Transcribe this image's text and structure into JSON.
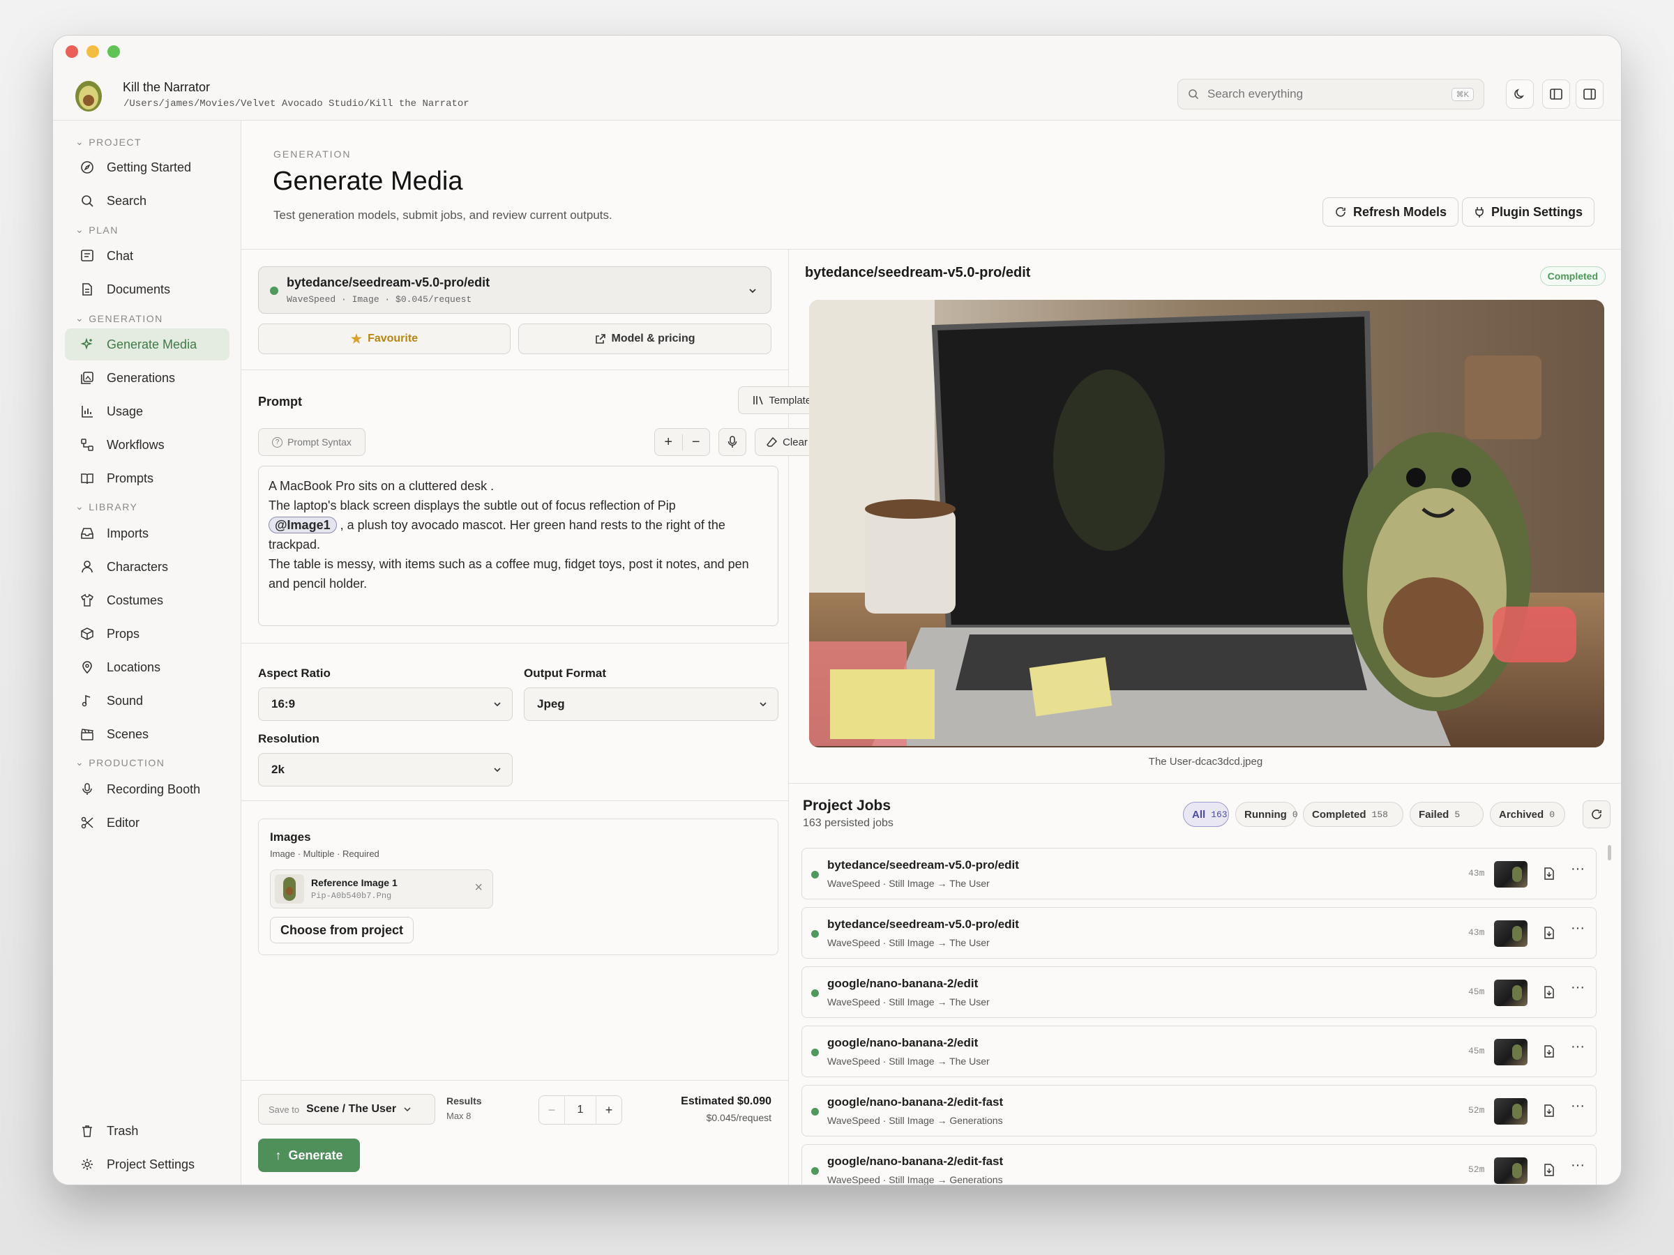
{
  "app": {
    "name": "Kill the Narrator",
    "path": "/Users/james/Movies/Velvet Avocado Studio/Kill the Narrator"
  },
  "search": {
    "placeholder": "Search everything",
    "shortcut": "⌘K"
  },
  "sidebar": {
    "sections": [
      "PROJECT",
      "PLAN",
      "GENERATION",
      "LIBRARY",
      "PRODUCTION"
    ],
    "items": [
      {
        "label": "Getting Started",
        "icon": "compass-icon"
      },
      {
        "label": "Search",
        "icon": "search-icon"
      },
      {
        "label": "Chat",
        "icon": "chat-icon"
      },
      {
        "label": "Documents",
        "icon": "document-icon"
      },
      {
        "label": "Generate Media",
        "icon": "sparkle-icon",
        "active": true
      },
      {
        "label": "Generations",
        "icon": "gallery-icon"
      },
      {
        "label": "Usage",
        "icon": "bar-chart-icon"
      },
      {
        "label": "Workflows",
        "icon": "workflow-icon"
      },
      {
        "label": "Prompts",
        "icon": "book-icon"
      },
      {
        "label": "Imports",
        "icon": "inbox-icon"
      },
      {
        "label": "Characters",
        "icon": "user-icon"
      },
      {
        "label": "Costumes",
        "icon": "shirt-icon"
      },
      {
        "label": "Props",
        "icon": "box-icon"
      },
      {
        "label": "Locations",
        "icon": "pin-icon"
      },
      {
        "label": "Sound",
        "icon": "music-icon"
      },
      {
        "label": "Scenes",
        "icon": "clapper-icon"
      },
      {
        "label": "Recording Booth",
        "icon": "mic-icon"
      },
      {
        "label": "Editor",
        "icon": "scissors-icon"
      }
    ],
    "bottom": [
      {
        "label": "Trash",
        "icon": "trash-icon"
      },
      {
        "label": "Project Settings",
        "icon": "gear-icon"
      }
    ]
  },
  "header": {
    "eyebrow": "GENERATION",
    "title": "Generate Media",
    "subtitle": "Test generation models, submit jobs, and review current outputs.",
    "refresh_label": "Refresh Models",
    "plugin_label": "Plugin Settings"
  },
  "model": {
    "name": "bytedance/seedream-v5.0-pro/edit",
    "meta": "WaveSpeed · Image · $0.045/request",
    "favourite_label": "Favourite",
    "pricing_label": "Model & pricing"
  },
  "prompt": {
    "label": "Prompt",
    "templates_label": "Templates",
    "syntax_label": "Prompt Syntax",
    "clear_label": "Clear",
    "line1": "A MacBook Pro sits on a cluttered desk .",
    "line2": "The laptop's black screen displays the subtle out of focus reflection of Pip",
    "mention": "@Image1",
    "line3": ", a plush toy avocado mascot. Her green hand rests to the right of the trackpad.",
    "line4": "The table is messy, with items such as a coffee mug, fidget toys, post it notes, and pen and pencil holder."
  },
  "options": {
    "aspect_label": "Aspect Ratio",
    "aspect_value": "16:9",
    "format_label": "Output Format",
    "format_value": "Jpeg",
    "resolution_label": "Resolution",
    "resolution_value": "2k"
  },
  "images": {
    "title": "Images",
    "meta": "Image · Multiple · Required",
    "ref_name": "Reference Image 1",
    "ref_file": "Pip-A0b540b7.Png",
    "choose_label": "Choose from project"
  },
  "footer": {
    "save_to_label": "Save to",
    "save_to_value": "Scene / The User",
    "results_label": "Results",
    "results_max": "Max 8",
    "results_value": "1",
    "estimated": "Estimated $0.090",
    "per_request": "$0.045/request",
    "generate_label": "Generate"
  },
  "output": {
    "title": "bytedance/seedream-v5.0-pro/edit",
    "status": "Completed",
    "caption": "The User-dcac3dcd.jpeg"
  },
  "jobs": {
    "title": "Project Jobs",
    "subtitle": "163 persisted jobs",
    "tabs": [
      {
        "label": "All",
        "count": "163",
        "active": true
      },
      {
        "label": "Running",
        "count": "0"
      },
      {
        "label": "Completed",
        "count": "158"
      },
      {
        "label": "Failed",
        "count": "5"
      },
      {
        "label": "Archived",
        "count": "0"
      }
    ],
    "rows": [
      {
        "name": "bytedance/seedream-v5.0-pro/edit",
        "meta": "WaveSpeed · Still Image → The User",
        "age": "43m"
      },
      {
        "name": "bytedance/seedream-v5.0-pro/edit",
        "meta": "WaveSpeed · Still Image → The User",
        "age": "43m"
      },
      {
        "name": "google/nano-banana-2/edit",
        "meta": "WaveSpeed · Still Image → The User",
        "age": "45m"
      },
      {
        "name": "google/nano-banana-2/edit",
        "meta": "WaveSpeed · Still Image → The User",
        "age": "45m"
      },
      {
        "name": "google/nano-banana-2/edit-fast",
        "meta": "WaveSpeed · Still Image → Generations",
        "age": "52m"
      },
      {
        "name": "google/nano-banana-2/edit-fast",
        "meta": "WaveSpeed · Still Image → Generations",
        "age": "52m"
      }
    ]
  },
  "colors": {
    "accent": "#4e8f5a",
    "active_tab": "#4a4aa8",
    "success": "#4b9a58"
  }
}
